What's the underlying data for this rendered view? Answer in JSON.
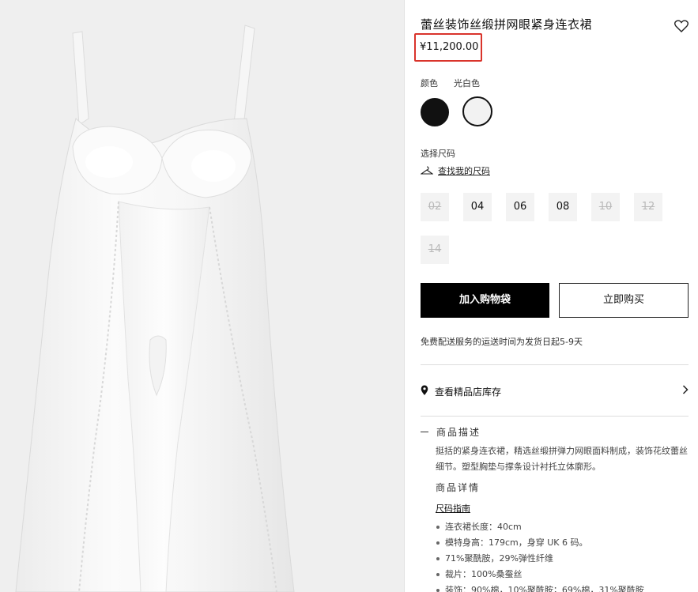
{
  "product": {
    "title": "蕾丝装饰丝缎拼网眼紧身连衣裙",
    "price": "¥11,200.00",
    "wishlist_icon": "heart-icon"
  },
  "color": {
    "label": "颜色",
    "selected": "光白色",
    "swatches": [
      {
        "name": "black",
        "hex": "#111111"
      },
      {
        "name": "optic-white",
        "hex": "#f2f2f2"
      }
    ]
  },
  "size": {
    "label": "选择尺码",
    "guide_link": "查找我的尺码",
    "options": [
      {
        "label": "02",
        "available": false
      },
      {
        "label": "04",
        "available": true
      },
      {
        "label": "06",
        "available": true
      },
      {
        "label": "08",
        "available": true
      },
      {
        "label": "10",
        "available": false
      },
      {
        "label": "12",
        "available": false
      },
      {
        "label": "14",
        "available": false
      }
    ]
  },
  "actions": {
    "add_to_bag": "加入购物袋",
    "buy_now": "立即购买"
  },
  "delivery_note": "免费配送服务的运送时间为发货日起5-9天",
  "store_stock": {
    "label": "查看精品店库存",
    "icon": "location-pin-icon"
  },
  "description": {
    "heading": "商品描述",
    "text": "挺括的紧身连衣裙，精选丝缎拼弹力网眼面料制成，装饰花纹蕾丝细节。塑型胸垫与撑条设计衬托立体廓形。"
  },
  "details": {
    "heading": "商品详情",
    "size_guide_link": "尺码指南",
    "items": [
      "连衣裙长度：40cm",
      "模特身高：179cm，身穿 UK 6 码。",
      "71%聚酰胺，29%弹性纤维",
      "裁片：100%桑蚕丝",
      "装饰：90%棉，10%聚酰胺；69%棉，31%聚酰胺"
    ]
  },
  "colors": {
    "highlight": "#d9342b",
    "primary_button": "#000000",
    "image_background": "#efefef"
  }
}
